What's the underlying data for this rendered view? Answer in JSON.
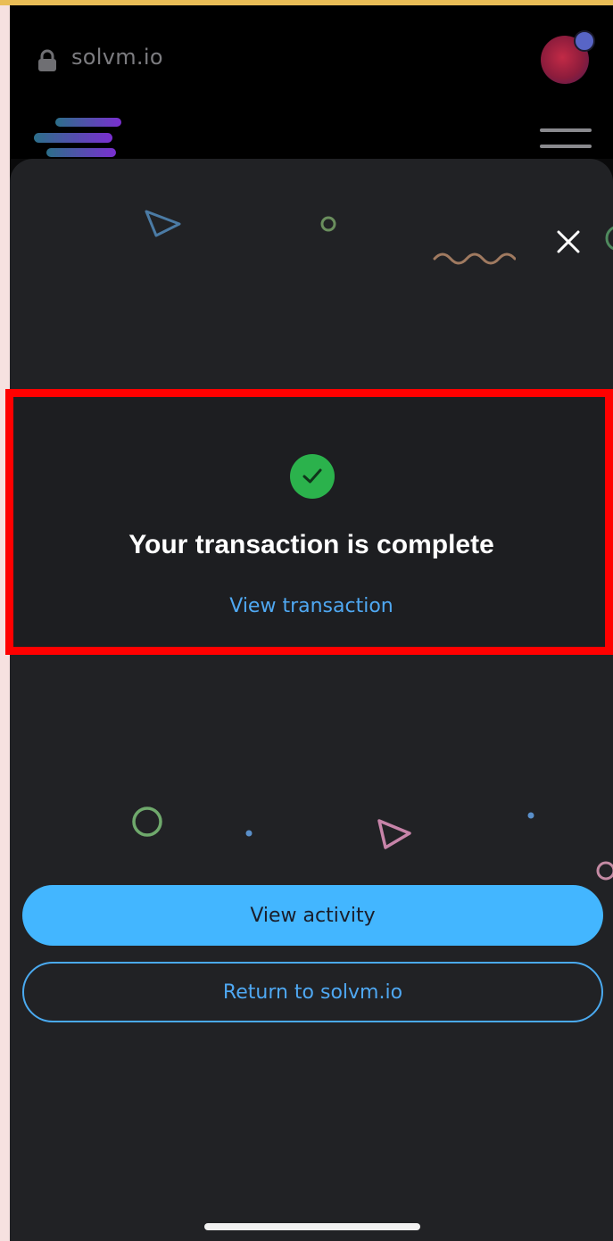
{
  "browser": {
    "url": "solvm.io",
    "lock_icon": "lock-icon",
    "menu_icon": "hamburger-menu-icon",
    "account_icon": "account-avatar-icon"
  },
  "dialog": {
    "close_icon": "close-icon",
    "status_icon": "check-circle-icon",
    "title": "Your transaction is complete",
    "view_transaction_label": "View transaction",
    "primary_button_label": "View activity",
    "secondary_button_label": "Return to solvm.io"
  },
  "colors": {
    "accent": "#43b6ff",
    "link": "#4fa8f2",
    "success": "#2bb24c",
    "sheet_background": "#212225",
    "highlight_border": "#ff0000"
  }
}
